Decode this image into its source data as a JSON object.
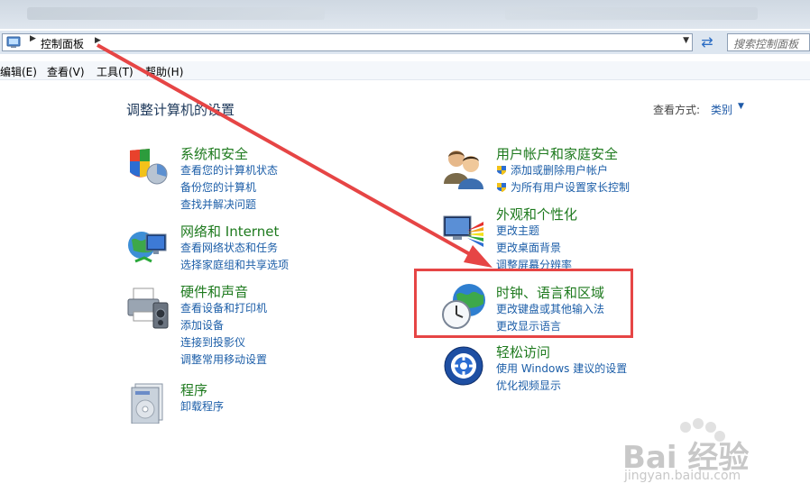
{
  "addressbar": {
    "crumb": "控制面板",
    "search_placeholder": "搜索控制面板"
  },
  "menubar": {
    "items": [
      "编辑(E)",
      "查看(V)",
      "工具(T)",
      "帮助(H)"
    ]
  },
  "page": {
    "title": "调整计算机的设置",
    "view_label": "查看方式:",
    "view_value": "类别"
  },
  "categories": {
    "system_security": {
      "title": "系统和安全",
      "links": [
        "查看您的计算机状态",
        "备份您的计算机",
        "查找并解决问题"
      ]
    },
    "network": {
      "title": "网络和 Internet",
      "links": [
        "查看网络状态和任务",
        "选择家庭组和共享选项"
      ]
    },
    "hardware": {
      "title": "硬件和声音",
      "links": [
        "查看设备和打印机",
        "添加设备",
        "连接到投影仪",
        "调整常用移动设置"
      ]
    },
    "programs": {
      "title": "程序",
      "links": [
        "卸载程序"
      ]
    },
    "user_accounts": {
      "title": "用户帐户和家庭安全",
      "links": [
        "添加或删除用户帐户",
        "为所有用户设置家长控制"
      ]
    },
    "appearance": {
      "title": "外观和个性化",
      "links": [
        "更改主题",
        "更改桌面背景",
        "调整屏幕分辨率"
      ]
    },
    "clock_language": {
      "title": "时钟、语言和区域",
      "links": [
        "更改键盘或其他输入法",
        "更改显示语言"
      ]
    },
    "ease_access": {
      "title": "轻松访问",
      "links": [
        "使用 Windows 建议的设置",
        "优化视频显示"
      ]
    }
  },
  "watermark": {
    "text": "Bai 经验",
    "url": "jingyan.baidu.com"
  },
  "colors": {
    "heading_green": "#1e7a1e",
    "link_blue": "#1c5ea8",
    "highlight_red": "#e64545"
  }
}
